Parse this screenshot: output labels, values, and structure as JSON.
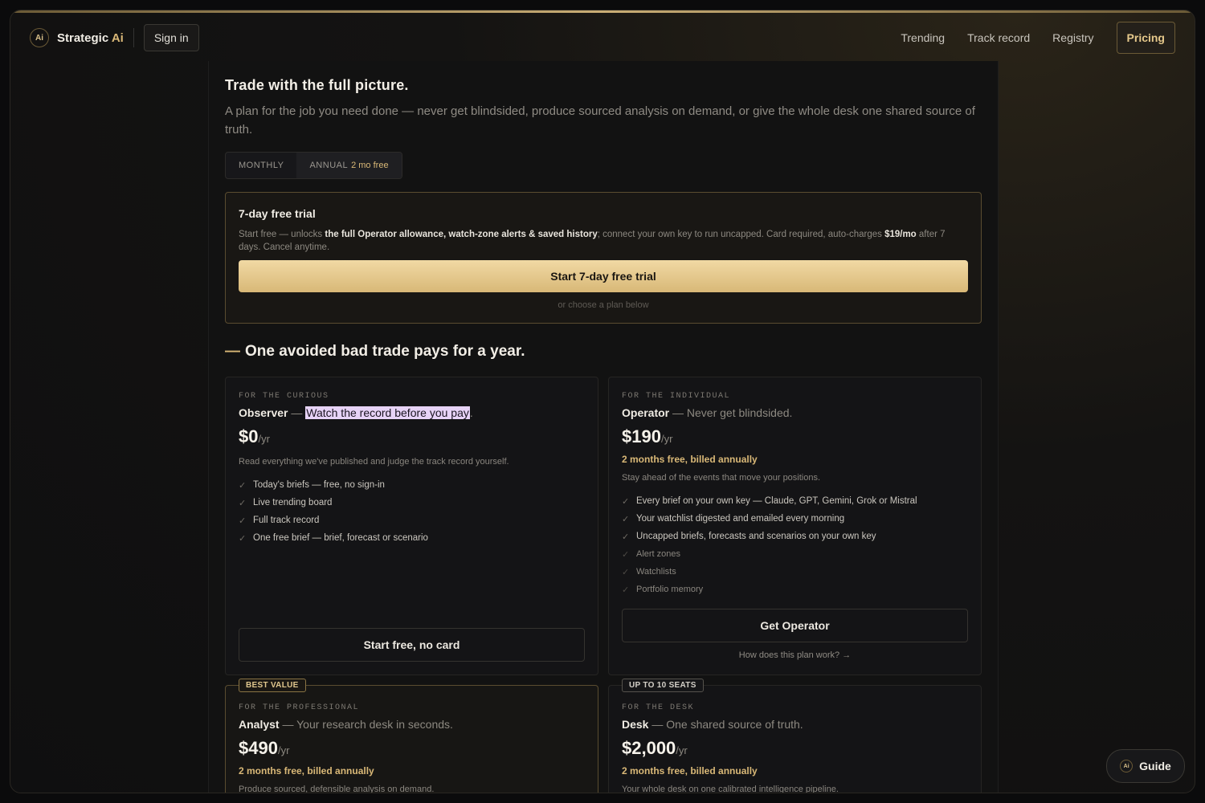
{
  "brand": {
    "logo": "Ai",
    "name": "Strategic",
    "name_accent": "Ai"
  },
  "nav": {
    "signin": "Sign in",
    "links": [
      "Trending",
      "Track record",
      "Registry"
    ],
    "pricing": "Pricing"
  },
  "hero": {
    "title": "Trade with the full picture.",
    "subtitle": "A plan for the job you need done — never get blindsided, produce sourced analysis on demand, or give the whole desk one shared source of truth."
  },
  "billing_toggle": {
    "monthly": "MONTHLY",
    "annual": "ANNUAL",
    "annual_note": "2 mo free"
  },
  "trial": {
    "title": "7-day free trial",
    "text_1": "Start free — unlocks ",
    "text_bold_1": "the full Operator allowance, watch-zone alerts & saved history",
    "text_2": "; connect your own key to run uncapped. Card required, auto-charges ",
    "text_bold_2": "$19/mo",
    "text_3": " after 7 days. Cancel anytime.",
    "cta": "Start 7-day free trial",
    "or": "or choose a plan below"
  },
  "section": {
    "dash": "—",
    "title": "One avoided bad trade pays for a year."
  },
  "plans": {
    "observer": {
      "eyebrow": "FOR THE CURIOUS",
      "name": "Observer",
      "sep": " — ",
      "tagline": "Watch the record before you pay",
      "tail": ".",
      "price": "$0",
      "unit": "/yr",
      "desc": "Read everything we've published and judge the track record yourself.",
      "features": [
        "Today's briefs — free, no sign-in",
        "Live trending board",
        "Full track record",
        "One free brief — brief, forecast or scenario"
      ],
      "cta": "Start free, no card"
    },
    "operator": {
      "eyebrow": "FOR THE INDIVIDUAL",
      "name": "Operator",
      "tagline": " — Never get blindsided.",
      "price": "$190",
      "unit": "/yr",
      "billed": "2 months free, billed annually",
      "desc": "Stay ahead of the events that move your positions.",
      "features": [
        "Every brief on your own key — Claude, GPT, Gemini, Grok or Mistral",
        "Your watchlist digested and emailed every morning",
        "Uncapped briefs, forecasts and scenarios on your own key"
      ],
      "features_dim": [
        "Alert zones",
        "Watchlists",
        "Portfolio memory"
      ],
      "cta": "Get Operator",
      "link": "How does this plan work? →"
    },
    "analyst": {
      "badge": "BEST VALUE",
      "eyebrow": "FOR THE PROFESSIONAL",
      "name": "Analyst",
      "tagline": " — Your research desk in seconds.",
      "price": "$490",
      "unit": "/yr",
      "billed": "2 months free, billed annually",
      "desc": "Produce sourced, defensible analysis on demand."
    },
    "desk": {
      "badge": "UP TO 10 SEATS",
      "eyebrow": "FOR THE DESK",
      "name": "Desk",
      "tagline": " — One shared source of truth.",
      "price": "$2,000",
      "unit": "/yr",
      "billed": "2 months free, billed annually",
      "desc": "Your whole desk on one calibrated intelligence pipeline."
    }
  },
  "guide": {
    "label": "Guide"
  },
  "icons": {
    "check": "check-icon",
    "logo": "brand-logo-icon"
  },
  "colors": {
    "accent": "#d9b877",
    "cta_gradient_top": "#f1d9a4",
    "cta_gradient_bottom": "#d8b877",
    "background": "#121212"
  }
}
